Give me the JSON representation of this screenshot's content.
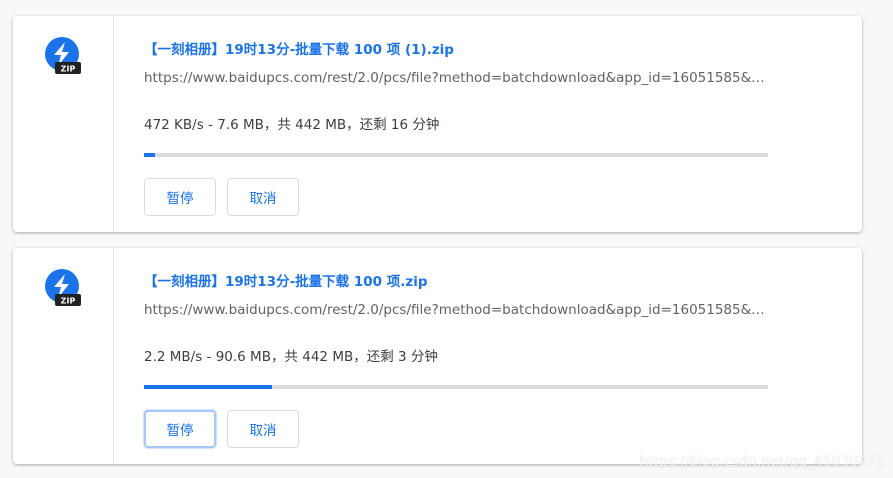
{
  "colors": {
    "accent": "#1a73e8",
    "track": "#dadce0",
    "zip_badge": "#202124"
  },
  "downloads": [
    {
      "icon": "zip-file-icon",
      "icon_badge": "ZIP",
      "filename": "【一刻相册】19时13分-批量下载 100 项 (1).zip",
      "url": "https://www.baidupcs.com/rest/2.0/pcs/file?method=batchdownload&app_id=16051585&…",
      "status": "472 KB/s - 7.6 MB，共 442 MB，还剩 16 分钟",
      "progress": 0.017,
      "pause_label": "暂停",
      "cancel_label": "取消"
    },
    {
      "icon": "zip-file-icon",
      "icon_badge": "ZIP",
      "filename": "【一刻相册】19时13分-批量下载 100 项.zip",
      "url": "https://www.baidupcs.com/rest/2.0/pcs/file?method=batchdownload&app_id=16051585&…",
      "status": "2.2 MB/s - 90.6 MB，共 442 MB，还剩 3 分钟",
      "progress": 0.205,
      "pause_label": "暂停",
      "cancel_label": "取消"
    }
  ],
  "watermark": "https://blog.csdn.net/qq_45030271"
}
